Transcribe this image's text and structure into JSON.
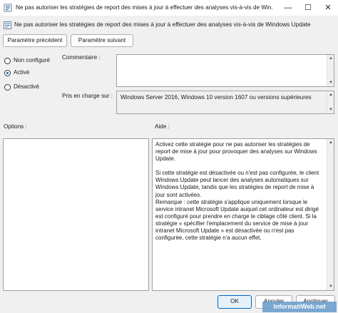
{
  "window": {
    "title": "Ne pas autoriser les stratégies de report des mises à jour à effectuer des analyses vis-à-vis de Win...",
    "minimize_glyph": "—",
    "maximize_glyph": "☐",
    "close_glyph": "✕"
  },
  "policy": {
    "name": "Ne pas autoriser les stratégies de report des mises à jour à effectuer des analyses vis-à-vis de Windows Update"
  },
  "nav": {
    "previous_label": "Paramètre précédent",
    "next_label": "Paramètre suivant"
  },
  "state": {
    "options": [
      {
        "label": "Non configuré",
        "selected": false
      },
      {
        "label": "Activé",
        "selected": true
      },
      {
        "label": "Désactivé",
        "selected": false
      }
    ]
  },
  "fields": {
    "comment_label": "Commentaire :",
    "comment_value": "",
    "supported_label": "Pris en charge sur :",
    "supported_value": "Windows Server 2016, Windows 10 version 1607 ou versions supérieures"
  },
  "panels": {
    "options_label": "Options :",
    "help_label": "Aide :",
    "help_paragraphs": [
      "Activez cette stratégie pour ne pas autoriser les stratégies de report de mise à jour pour provoquer des analyses sur Windows Update.",
      "Si cette stratégie est désactivée ou n'est pas configurée, le client Windows Update peut lancer des analyses automatiques sur Windows Update, tandis que les stratégies de report de mise à jour sont activées.",
      "Remarque : cette stratégie s'applique uniquement lorsque le service intranet Microsoft Update auquel cet ordinateur est dirigé est configuré pour prendre en charge le ciblage côté client. Si la stratégie « spécifier l'emplacement du service de mise à jour intranet Microsoft Update » est désactivée ou n'est pas configurée, cette stratégie n'a aucun effet."
    ]
  },
  "footer": {
    "ok_label": "OK",
    "cancel_label": "Annuler",
    "apply_label": "Appliquer"
  },
  "watermark": {
    "text": "InformatiWeb.net"
  },
  "colors": {
    "accent": "#1f5fb4",
    "ok_border": "#0067c0"
  }
}
